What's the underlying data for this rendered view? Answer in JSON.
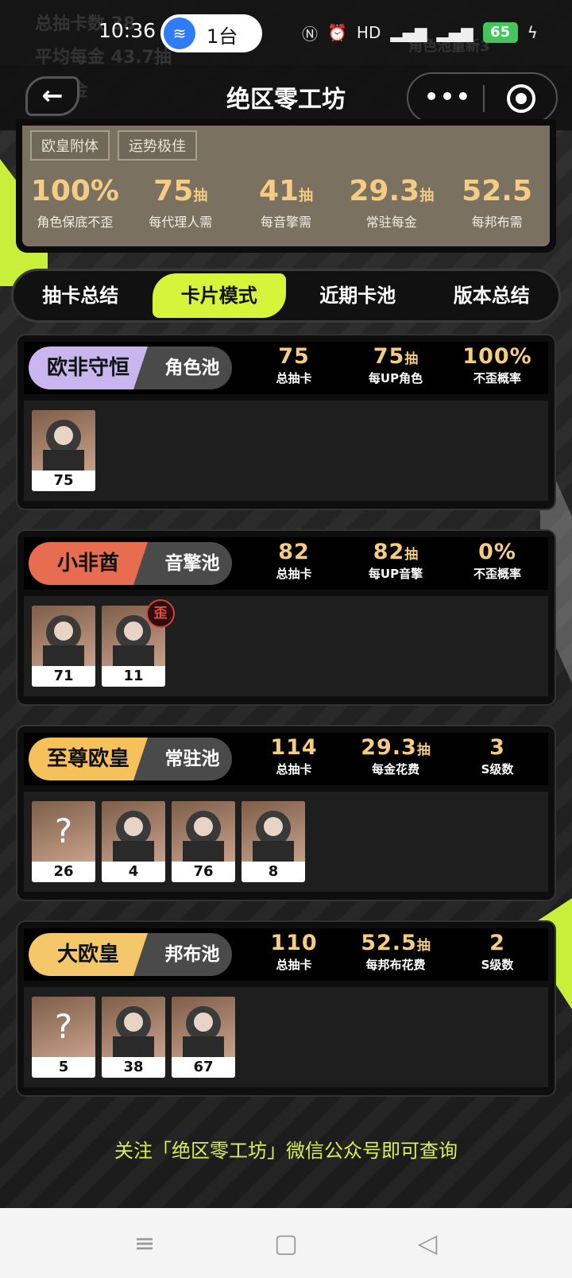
{
  "status": {
    "time": "10:36",
    "hotspot_label": "1台",
    "battery": "65",
    "signal": "5G"
  },
  "ghost": {
    "line1": "总抽卡数 38",
    "line2": "平均每金 43.7抽",
    "line3": "数 8金",
    "right": "角色池重新3"
  },
  "nav": {
    "title": "绝区零工坊",
    "more": "•••"
  },
  "summary": {
    "tags": [
      "欧皇附体",
      "运势极佳"
    ],
    "stats": [
      {
        "value": "100%",
        "unit": "",
        "label": "角色保底不歪"
      },
      {
        "value": "75",
        "unit": "抽",
        "label": "每代理人需"
      },
      {
        "value": "41",
        "unit": "抽",
        "label": "每音擎需"
      },
      {
        "value": "29.3",
        "unit": "抽",
        "label": "常驻每金"
      },
      {
        "value": "52.5",
        "unit": "",
        "label": "每邦布需"
      }
    ]
  },
  "tabs": [
    "抽卡总结",
    "卡片模式",
    "近期卡池",
    "版本总结"
  ],
  "active_tab": 1,
  "pools": [
    {
      "title": "欧非守恒",
      "pool": "角色池",
      "color": "#c9b6ef",
      "stats": [
        {
          "value": "75",
          "unit": "",
          "label": "总抽卡"
        },
        {
          "value": "75",
          "unit": "抽",
          "label": "每UP角色"
        },
        {
          "value": "100%",
          "unit": "",
          "label": "不歪概率"
        }
      ],
      "items": [
        {
          "count": "75",
          "icon": "character-portrait",
          "unknown": false,
          "off_banner": false
        }
      ]
    },
    {
      "title": "小非酋",
      "pool": "音擎池",
      "color": "#e86c4f",
      "stats": [
        {
          "value": "82",
          "unit": "",
          "label": "总抽卡"
        },
        {
          "value": "82",
          "unit": "抽",
          "label": "每UP音擎"
        },
        {
          "value": "0%",
          "unit": "",
          "label": "不歪概率"
        }
      ],
      "items": [
        {
          "count": "71",
          "icon": "w-engine-house",
          "unknown": false,
          "off_banner": false
        },
        {
          "count": "11",
          "icon": "w-engine-sphere",
          "unknown": false,
          "off_banner": true,
          "off_banner_label": "歪"
        }
      ]
    },
    {
      "title": "至尊欧皇",
      "pool": "常驻池",
      "color": "#f6c15a",
      "stats": [
        {
          "value": "114",
          "unit": "",
          "label": "总抽卡"
        },
        {
          "value": "29.3",
          "unit": "抽",
          "label": "每金花费"
        },
        {
          "value": "3",
          "unit": "",
          "label": "S级数"
        }
      ],
      "items": [
        {
          "count": "26",
          "icon": "unknown",
          "unknown": true,
          "unknown_label": "?"
        },
        {
          "count": "4",
          "icon": "character-portrait",
          "unknown": false
        },
        {
          "count": "76",
          "icon": "w-engine-sphere",
          "unknown": false
        },
        {
          "count": "8",
          "icon": "character-portrait",
          "unknown": false
        }
      ]
    },
    {
      "title": "大欧皇",
      "pool": "邦布池",
      "color": "#f4c76a",
      "stats": [
        {
          "value": "110",
          "unit": "",
          "label": "总抽卡"
        },
        {
          "value": "52.5",
          "unit": "抽",
          "label": "每邦布花费"
        },
        {
          "value": "2",
          "unit": "",
          "label": "S级数"
        }
      ],
      "items": [
        {
          "count": "5",
          "icon": "unknown",
          "unknown": true,
          "unknown_label": "?"
        },
        {
          "count": "38",
          "icon": "bangboo-shark",
          "unknown": false
        },
        {
          "count": "67",
          "icon": "bangboo-rabbit",
          "unknown": false
        }
      ]
    }
  ],
  "footer": "关注「绝区零工坊」微信公众号即可查询",
  "system_nav": {
    "menu": "≡",
    "home": "▢",
    "back": "◁"
  }
}
